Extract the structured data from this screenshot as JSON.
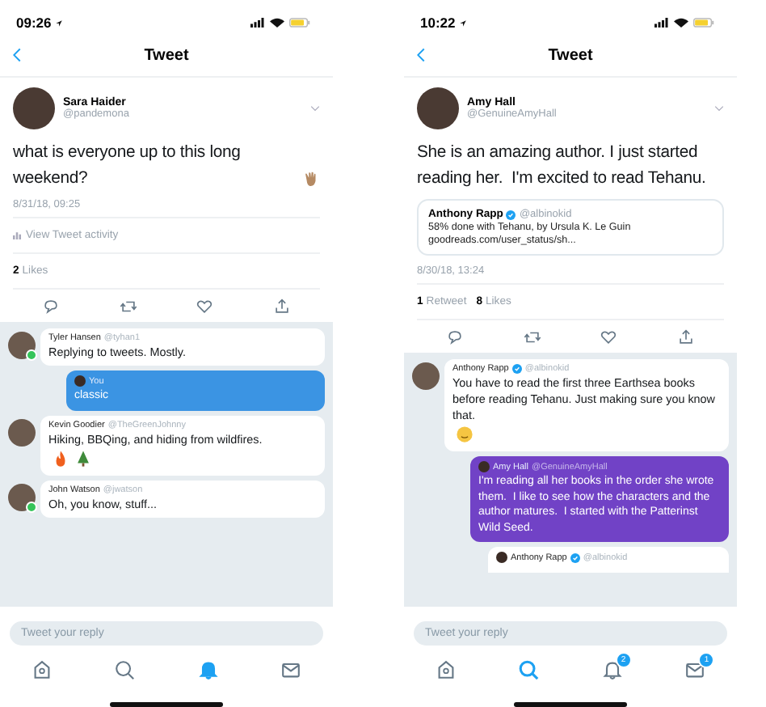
{
  "phones": [
    {
      "time": "09:26",
      "title": "Tweet",
      "tweet": {
        "name": "Sara Haider",
        "handle": "@pandemona",
        "text": "what is everyone up to this long weekend?",
        "text_icon": {
          "kind": "wave"
        },
        "date": "8/31/18, 09:25",
        "activity": "View Tweet activity",
        "stats": [
          {
            "count": "2",
            "label": "Likes"
          }
        ]
      },
      "thread": [
        {
          "kind": "reply",
          "name": "Tyler Hansen",
          "handle": "@tyhan1",
          "verified": false,
          "online": true,
          "text": "Replying to tweets. Mostly."
        },
        {
          "kind": "mine",
          "name": "You",
          "text": "classic",
          "color": "#3b94e3"
        },
        {
          "kind": "reply",
          "name": "Kevin Goodier",
          "handle": "@TheGreenJohnny",
          "verified": false,
          "online": false,
          "text": "Hiking, BBQing, and hiding from wildfires.",
          "icons": [
            {
              "kind": "fire"
            },
            {
              "kind": "tree"
            }
          ]
        },
        {
          "kind": "reply",
          "name": "John Watson",
          "handle": "@jwatson",
          "verified": false,
          "online": true,
          "text": "Oh, you know, stuff..."
        }
      ],
      "reply_placeholder": "Tweet your reply",
      "tabs": [
        {
          "kind": "home",
          "selected": false
        },
        {
          "kind": "search",
          "selected": false
        },
        {
          "kind": "bell",
          "selected": true
        },
        {
          "kind": "mail",
          "selected": false
        }
      ]
    },
    {
      "time": "10:22",
      "title": "Tweet",
      "tweet": {
        "name": "Amy Hall",
        "handle": "@GenuineAmyHall",
        "text": "She is an amazing author. I just started reading her.  I'm excited to read Tehanu.",
        "quote": {
          "name": "Anthony Rapp",
          "verified": true,
          "handle": "@albinokid",
          "text": "58% done with Tehanu, by Ursula K. Le Guin",
          "link": "goodreads.com/user_status/sh..."
        },
        "date": "8/30/18, 13:24",
        "stats": [
          {
            "count": "1",
            "label": "Retweet"
          },
          {
            "count": "8",
            "label": "Likes"
          }
        ]
      },
      "thread": [
        {
          "kind": "reply",
          "name": "Anthony Rapp",
          "handle": "@albinokid",
          "verified": true,
          "online": false,
          "text": "You have to read the first three Earthsea books before reading Tehanu. Just making sure you know that.",
          "icons": [
            {
              "kind": "smile"
            }
          ]
        },
        {
          "kind": "mine",
          "name": "Amy Hall",
          "handle": "@GenuineAmyHall",
          "text": "I'm reading all her books in the order she wrote them.  I like to see how the characters and the author matures.  I started with the Patterinst Wild Seed.",
          "color": "#7142c6"
        },
        {
          "kind": "nested",
          "name": "Anthony Rapp",
          "handle": "@albinokid",
          "verified": true
        }
      ],
      "reply_placeholder": "Tweet your reply",
      "tabs": [
        {
          "kind": "home",
          "selected": false
        },
        {
          "kind": "search",
          "selected": true
        },
        {
          "kind": "bell",
          "selected": false,
          "badge": "2"
        },
        {
          "kind": "mail",
          "selected": false,
          "badge": "1"
        }
      ]
    }
  ]
}
